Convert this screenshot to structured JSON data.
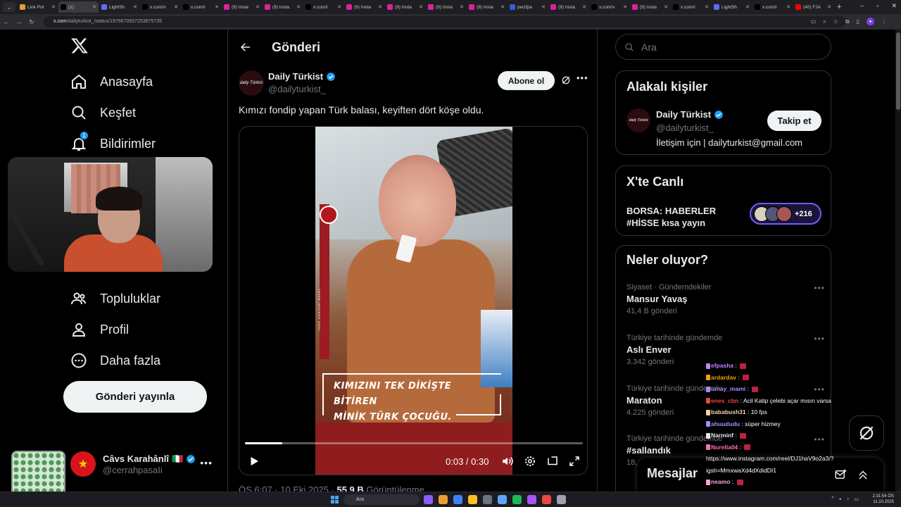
{
  "browser": {
    "tabs": [
      {
        "label": "Link Pol",
        "color": "#e0a030",
        "active": false
      },
      {
        "label": "(1)",
        "color": "#000000",
        "active": true
      },
      {
        "label": "LightSh",
        "color": "#5b6cff",
        "active": false
      },
      {
        "label": "x.com/v",
        "color": "#000000",
        "active": false
      },
      {
        "label": "x.com/i",
        "color": "#000000",
        "active": false
      },
      {
        "label": "(9) Insta",
        "color": "#d6249f",
        "active": false
      },
      {
        "label": "(9) Insta",
        "color": "#d6249f",
        "active": false
      },
      {
        "label": "x.com/i",
        "color": "#000000",
        "active": false
      },
      {
        "label": "(9) Insta",
        "color": "#d6249f",
        "active": false
      },
      {
        "label": "(9) Insta",
        "color": "#d6249f",
        "active": false
      },
      {
        "label": "(9) Insta",
        "color": "#d6249f",
        "active": false
      },
      {
        "label": "(9) Insta",
        "color": "#d6249f",
        "active": false
      },
      {
        "label": "pw1fpa",
        "color": "#3a5bd9",
        "active": false
      },
      {
        "label": "(9) Insta",
        "color": "#d6249f",
        "active": false
      },
      {
        "label": "x.com/v",
        "color": "#000000",
        "active": false
      },
      {
        "label": "(9) Insta",
        "color": "#d6249f",
        "active": false
      },
      {
        "label": "x.com/i",
        "color": "#000000",
        "active": false
      },
      {
        "label": "LightSh",
        "color": "#5b6cff",
        "active": false
      },
      {
        "label": "x.com/i",
        "color": "#000000",
        "active": false
      },
      {
        "label": "(40) FJA",
        "color": "#ff0000",
        "active": false
      }
    ],
    "url_host": "x.com",
    "url_path": "/dailyturkist_/status/1976670937253875735"
  },
  "nav": {
    "items": [
      {
        "key": "home",
        "label": "Anasayfa"
      },
      {
        "key": "explore",
        "label": "Keşfet"
      },
      {
        "key": "notifications",
        "label": "Bildirimler",
        "badge": "1"
      },
      {
        "key": "communities",
        "label": "Topluluklar"
      },
      {
        "key": "profile",
        "label": "Profil"
      },
      {
        "key": "more",
        "label": "Daha fazla"
      }
    ],
    "post_button": "Gönderi yayınla",
    "account": {
      "name": "Câvs Karahânlî",
      "flag": "🇮🇹",
      "handle": "@cerrahpasaIi"
    }
  },
  "main": {
    "title": "Gönderi",
    "post": {
      "author": "Daily Türkist",
      "handle": "@dailyturkist_",
      "avatar_text": "daily Türkist",
      "subscribe": "Abone ol",
      "text": "Kımızı fondip yapan Türk balası, keyiften dört köşe oldu.",
      "video": {
        "caption_line1": "KIMIZINI TEK DİKİŞTE BİTİREN",
        "caption_line2": "MİNİK TÜRK ÇOCUĞU.",
        "side_text": "TÜRK DÜNYASI HALKI",
        "time": "0:03 / 0:30",
        "progress": 0.11
      },
      "meta_prefix": "ÖS 6:07 · 10 Eki 2025 · ",
      "meta_views": "55,9 B",
      "meta_suffix": " Görüntülenme"
    }
  },
  "right": {
    "search_placeholder": "Ara",
    "related": {
      "title": "Alakalı kişiler",
      "name": "Daily Türkist",
      "handle": "@dailyturkist_",
      "bio": "İletişim için | dailyturkist@gmail.com",
      "follow": "Takip et"
    },
    "live": {
      "title": "X'te Canlı",
      "stream_title": "BORSA: HABERLER #HİSSE kısa yayın",
      "count": "+216"
    },
    "trends": {
      "title": "Neler oluyor?",
      "items": [
        {
          "context": "Siyaset · Gündemdekiler",
          "name": "Mansur Yavaş",
          "count": "41,4 B gönderi"
        },
        {
          "context": "Türkiye tarihinde gündemde",
          "name": "Aslı Enver",
          "count": "3.342 gönderi"
        },
        {
          "context": "Türkiye tarihinde gündemde",
          "name": "Maraton",
          "count": "4.225 gönderi"
        },
        {
          "context": "Türkiye tarihinde gündemde",
          "name": "#sallandık",
          "count": "18,"
        }
      ]
    }
  },
  "messages": {
    "title": "Mesajlar"
  },
  "chat": [
    {
      "user": "efpasha",
      "color": "#c084fc",
      "text": ""
    },
    {
      "user": "ardardav",
      "color": "#f59e0b",
      "text": ""
    },
    {
      "user": "umay_mami",
      "color": "#a78bfa",
      "text": ""
    },
    {
      "user": "enes_cbn",
      "color": "#ef4444",
      "text": "Acil Katip çelebi açar mısın varsa"
    },
    {
      "user": "bababush31",
      "color": "#f5d0a9",
      "text": "10 fps"
    },
    {
      "user": "ahuududu",
      "color": "#a78bfa",
      "text": "süper hizmey"
    },
    {
      "user": "Narminf",
      "color": "#e5e7eb",
      "text": ""
    },
    {
      "user": "Nurella04",
      "color": "#f472b6",
      "text": ""
    },
    {
      "user": "",
      "color": "#ffffff",
      "text": "https://www.instagram.com/reel/DJ1haV9o2a3/?"
    },
    {
      "user": "",
      "color": "#ffffff",
      "text": "igsh=MmxwaXd4dXdidDI1"
    },
    {
      "user": "neamo",
      "color": "#f9a8d4",
      "text": ""
    }
  ],
  "taskbar": {
    "search": "Ara",
    "time": "2:31:54 ÖS",
    "date": "11.10.2025"
  },
  "colors": {
    "accent": "#1d9bf0",
    "live": "#7856ff",
    "border": "#2f3336"
  }
}
